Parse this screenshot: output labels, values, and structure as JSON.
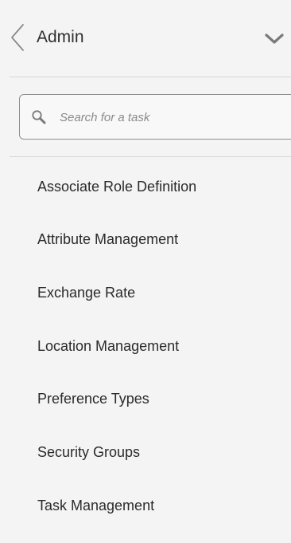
{
  "header": {
    "title": "Admin",
    "back_icon": "chevron-left-icon",
    "collapse_icon": "chevron-down-icon"
  },
  "search": {
    "placeholder": "Search for a task",
    "value": "",
    "icon": "search-icon"
  },
  "tasks": [
    {
      "label": "Associate Role Definition"
    },
    {
      "label": "Attribute Management"
    },
    {
      "label": "Exchange Rate"
    },
    {
      "label": "Location Management"
    },
    {
      "label": "Preference Types"
    },
    {
      "label": "Security Groups"
    },
    {
      "label": "Task Management"
    }
  ],
  "colors": {
    "background": "#f4f4f4",
    "text": "#2b2b2b",
    "divider": "#d7d7d7",
    "search_border": "#8f8f8f",
    "icon": "#7a7a7a"
  }
}
